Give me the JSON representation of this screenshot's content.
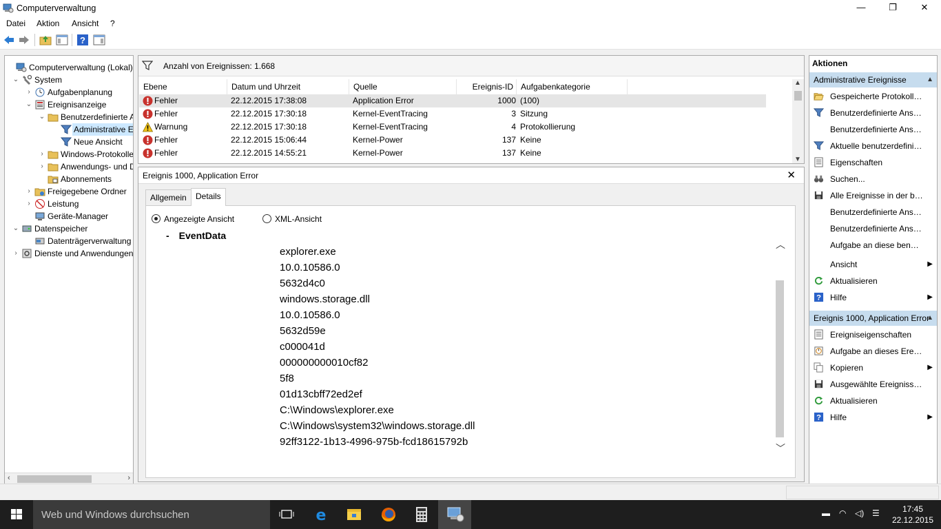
{
  "window": {
    "title": "Computerverwaltung",
    "controls": {
      "minimize": "—",
      "maximize": "❐",
      "close": "✕"
    }
  },
  "menu": [
    "Datei",
    "Aktion",
    "Ansicht",
    "?"
  ],
  "toolbar_icons": [
    "back-arrow-icon",
    "forward-arrow-icon",
    "up-folder-icon",
    "show-hide-tree-icon",
    "help-icon",
    "show-hide-action-pane-icon"
  ],
  "tree": [
    {
      "label": "Computerverwaltung (Lokal)",
      "level": 0,
      "expander": "",
      "icon": "computer-management-icon"
    },
    {
      "label": "System",
      "level": 1,
      "expander": "⌄",
      "icon": "system-tools-icon"
    },
    {
      "label": "Aufgabenplanung",
      "level": 2,
      "expander": "›",
      "icon": "task-scheduler-icon"
    },
    {
      "label": "Ereignisanzeige",
      "level": 2,
      "expander": "⌄",
      "icon": "event-viewer-icon"
    },
    {
      "label": "Benutzerdefinierte Ansichten",
      "level": 3,
      "expander": "⌄",
      "icon": "folder-icon"
    },
    {
      "label": "Administrative Ereignisse",
      "level": 4,
      "expander": "",
      "icon": "filter-icon",
      "selected": true
    },
    {
      "label": "Neue Ansicht",
      "level": 4,
      "expander": "",
      "icon": "filter-icon"
    },
    {
      "label": "Windows-Protokolle",
      "level": 3,
      "expander": "›",
      "icon": "folder-icon"
    },
    {
      "label": "Anwendungs- und Dienstprotokolle",
      "level": 3,
      "expander": "›",
      "icon": "folder-icon"
    },
    {
      "label": "Abonnements",
      "level": 3,
      "expander": "",
      "icon": "subscriptions-icon"
    },
    {
      "label": "Freigegebene Ordner",
      "level": 2,
      "expander": "›",
      "icon": "shared-folder-icon"
    },
    {
      "label": "Leistung",
      "level": 2,
      "expander": "›",
      "icon": "performance-icon"
    },
    {
      "label": "Geräte-Manager",
      "level": 2,
      "expander": "",
      "icon": "device-manager-icon"
    },
    {
      "label": "Datenspeicher",
      "level": 1,
      "expander": "⌄",
      "icon": "storage-icon"
    },
    {
      "label": "Datenträgerverwaltung",
      "level": 2,
      "expander": "",
      "icon": "disk-management-icon"
    },
    {
      "label": "Dienste und Anwendungen",
      "level": 1,
      "expander": "›",
      "icon": "services-icon"
    }
  ],
  "events": {
    "count_label": "Anzahl von Ereignissen: 1.668",
    "columns": [
      "Ebene",
      "Datum und Uhrzeit",
      "Quelle",
      "Ereignis-ID",
      "Aufgabenkategorie"
    ],
    "rows": [
      {
        "level": "Fehler",
        "type": "error",
        "datetime": "22.12.2015 17:38:08",
        "source": "Application Error",
        "id": "1000",
        "category": "(100)"
      },
      {
        "level": "Fehler",
        "type": "error",
        "datetime": "22.12.2015 17:30:18",
        "source": "Kernel-EventTracing",
        "id": "3",
        "category": "Sitzung"
      },
      {
        "level": "Warnung",
        "type": "warning",
        "datetime": "22.12.2015 17:30:18",
        "source": "Kernel-EventTracing",
        "id": "4",
        "category": "Protokollierung"
      },
      {
        "level": "Fehler",
        "type": "error",
        "datetime": "22.12.2015 15:06:44",
        "source": "Kernel-Power",
        "id": "137",
        "category": "Keine"
      },
      {
        "level": "Fehler",
        "type": "error",
        "datetime": "22.12.2015 14:55:21",
        "source": "Kernel-Power",
        "id": "137",
        "category": "Keine"
      }
    ]
  },
  "details": {
    "title": "Ereignis 1000, Application Error",
    "tabs": [
      "Allgemein",
      "Details"
    ],
    "views": [
      "Angezeigte Ansicht",
      "XML-Ansicht"
    ],
    "section": "EventData",
    "section_toggle": "-",
    "values": [
      "explorer.exe",
      "10.0.10586.0",
      "5632d4c0",
      "windows.storage.dll",
      "10.0.10586.0",
      "5632d59e",
      "c000041d",
      "000000000010cf82",
      "5f8",
      "01d13cbff72ed2ef",
      "C:\\Windows\\explorer.exe",
      "C:\\Windows\\system32\\windows.storage.dll",
      "92ff3122-1b13-4996-975b-fcd18615792b"
    ]
  },
  "actions": {
    "header": "Aktionen",
    "section1": "Administrative Ereignisse",
    "items1": [
      {
        "label": "Gespeicherte Protokolldatei öffnen...",
        "icon": "open-folder-icon"
      },
      {
        "label": "Benutzerdefinierte Ansicht erstellen...",
        "icon": "filter-icon"
      },
      {
        "label": "Benutzerdefinierte Ansicht importieren...",
        "icon": ""
      },
      {
        "label": "Aktuelle benutzerdefinierte Ansicht filtern...",
        "icon": "filter-icon"
      },
      {
        "label": "Eigenschaften",
        "icon": "properties-icon"
      },
      {
        "label": "Suchen...",
        "icon": "binoculars-icon"
      },
      {
        "label": "Alle Ereignisse in der benutzerdefinierten Ansicht speichern unter...",
        "icon": "save-icon"
      },
      {
        "label": "Benutzerdefinierte Ansicht exportieren...",
        "icon": ""
      },
      {
        "label": "Benutzerdefinierte Ansicht kopieren...",
        "icon": ""
      },
      {
        "label": "Aufgabe an diese benutzerdefinierte Ansicht anfügen...",
        "icon": ""
      },
      {
        "label": "Ansicht",
        "icon": "",
        "submenu": true
      },
      {
        "label": "Aktualisieren",
        "icon": "refresh-icon"
      },
      {
        "label": "Hilfe",
        "icon": "help-icon",
        "submenu": true
      }
    ],
    "section2": "Ereignis 1000, Application Error",
    "items2": [
      {
        "label": "Ereigniseigenschaften",
        "icon": "properties-icon"
      },
      {
        "label": "Aufgabe an dieses Ereignis anfügen...",
        "icon": "task-icon"
      },
      {
        "label": "Kopieren",
        "icon": "copy-icon",
        "submenu": true
      },
      {
        "label": "Ausgewählte Ereignisse speichern...",
        "icon": "save-icon"
      },
      {
        "label": "Aktualisieren",
        "icon": "refresh-icon"
      },
      {
        "label": "Hilfe",
        "icon": "help-icon",
        "submenu": true
      }
    ]
  },
  "taskbar": {
    "search_placeholder": "Web und Windows durchsuchen",
    "time": "17:45",
    "date": "22.12.2015"
  }
}
